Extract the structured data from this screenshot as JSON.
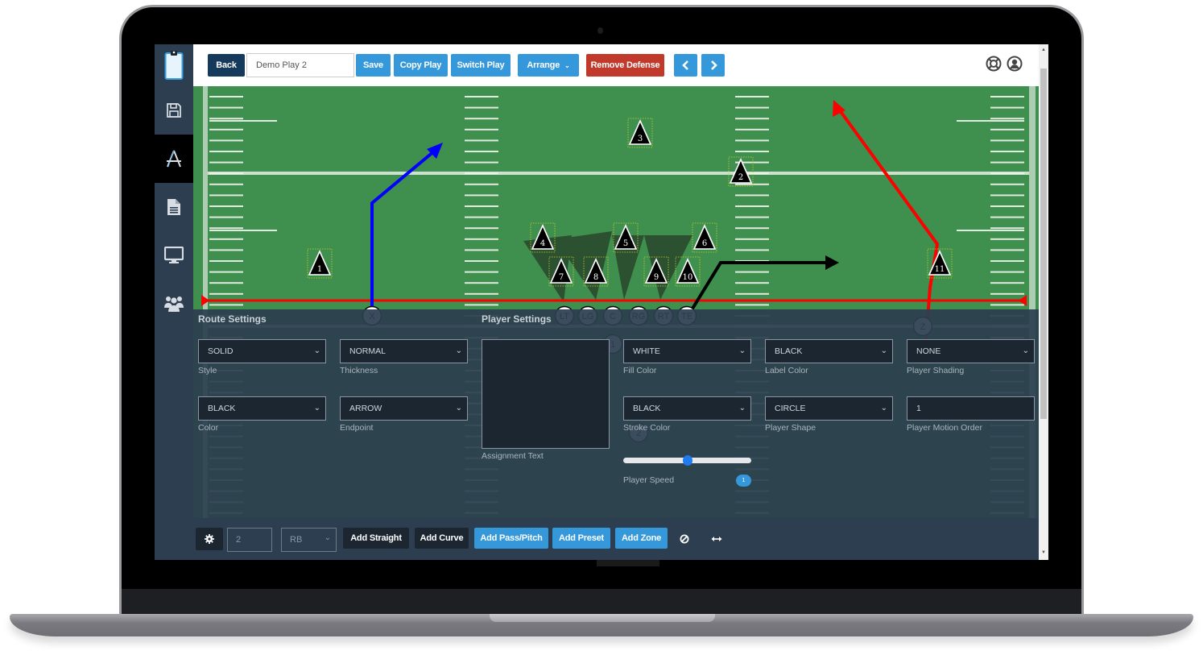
{
  "topbar": {
    "back_label": "Back",
    "play_name": "Demo Play 2",
    "save_label": "Save",
    "copy_label": "Copy Play",
    "switch_label": "Switch Play",
    "arrange_label": "Arrange",
    "remove_defense_label": "Remove Defense",
    "prev_icon": "chevron-left-icon",
    "next_icon": "chevron-right-icon",
    "help_icon": "lifebuoy-icon",
    "user_icon": "user-circle-icon"
  },
  "sidebar": {
    "items": [
      {
        "name": "clipboard",
        "icon": "clipboard-icon",
        "active": false
      },
      {
        "name": "save",
        "icon": "floppy-disk-icon",
        "active": false
      },
      {
        "name": "draw",
        "icon": "drafting-compass-icon",
        "active": true
      },
      {
        "name": "document",
        "icon": "document-icon",
        "active": false
      },
      {
        "name": "present",
        "icon": "monitor-icon",
        "active": false
      },
      {
        "name": "team",
        "icon": "users-icon",
        "active": false
      }
    ]
  },
  "field": {
    "defense": [
      "1",
      "2",
      "3",
      "4",
      "5",
      "6",
      "7",
      "8",
      "9",
      "10",
      "11"
    ],
    "offense": [
      "X",
      "LT",
      "LG",
      "C",
      "RG",
      "RT",
      "TE",
      "1",
      "2",
      "Z"
    ],
    "colors": {
      "grass": "#3f8f4e",
      "los": "#ff0000",
      "route_blue": "#0000ff",
      "route_red": "#ff0000",
      "route_black": "#000000"
    }
  },
  "route_settings": {
    "title": "Route Settings",
    "style": {
      "value": "SOLID",
      "label": "Style"
    },
    "thickness": {
      "value": "NORMAL",
      "label": "Thickness"
    },
    "color": {
      "value": "BLACK",
      "label": "Color"
    },
    "endpoint": {
      "value": "ARROW",
      "label": "Endpoint"
    }
  },
  "player_settings": {
    "title": "Player Settings",
    "assignment_label": "Assignment Text",
    "assignment_value": "",
    "fill_color": {
      "value": "WHITE",
      "label": "Fill Color"
    },
    "label_color": {
      "value": "BLACK",
      "label": "Label Color"
    },
    "shading": {
      "value": "NONE",
      "label": "Player Shading"
    },
    "stroke_color": {
      "value": "BLACK",
      "label": "Stroke Color"
    },
    "shape": {
      "value": "CIRCLE",
      "label": "Player Shape"
    },
    "motion_order": {
      "value": "1",
      "label": "Player Motion Order"
    },
    "speed": {
      "label": "Player Speed",
      "value": "1",
      "slider_fraction": 0.5
    }
  },
  "bottombar": {
    "gear_icon": "gear-icon",
    "number_value": "2",
    "position_value": "RB",
    "add_straight": "Add Straight",
    "add_curve": "Add Curve",
    "add_pass": "Add Pass/Pitch",
    "add_preset": "Add Preset",
    "add_zone": "Add Zone",
    "clear_icon": "ban-icon",
    "flip_icon": "arrows-horizontal-icon"
  }
}
